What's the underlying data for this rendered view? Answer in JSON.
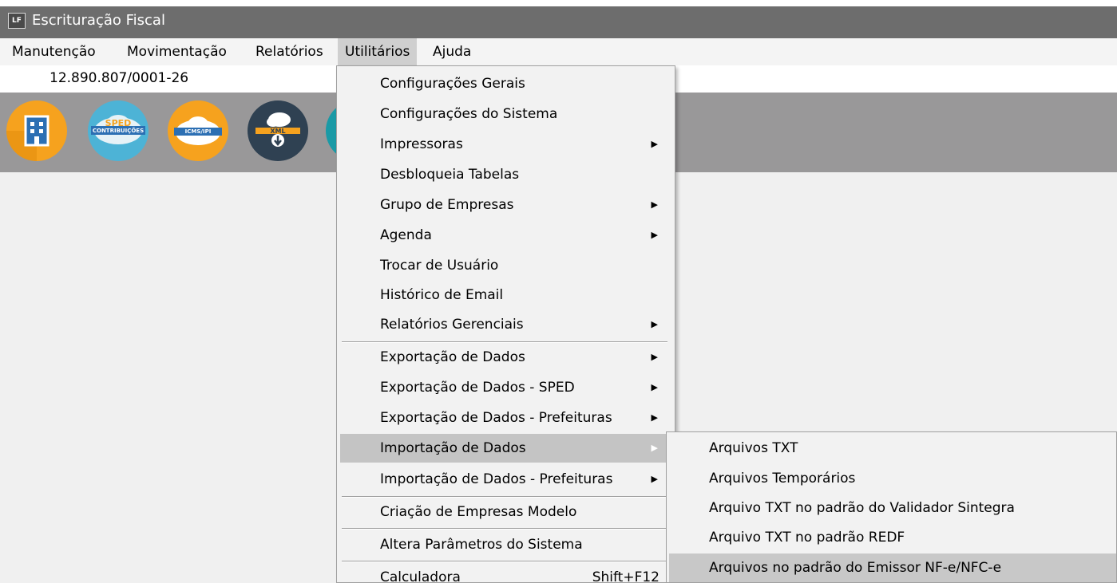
{
  "window": {
    "icon_text": "LF",
    "title": "Escrituração Fiscal"
  },
  "menubar": {
    "items": [
      "Manutenção",
      "Movimentação",
      "Relatórios",
      "Utilitários",
      "Ajuda"
    ],
    "active": "Utilitários"
  },
  "company": {
    "cnpj": "12.890.807/0001-26"
  },
  "toolbar": {
    "buttons": [
      {
        "name": "empresa-icon",
        "label": ""
      },
      {
        "name": "sped-contribuicoes-icon",
        "label_top": "SPED",
        "label_bottom": "CONTRIBUIÇÕES"
      },
      {
        "name": "icms-ipi-icon",
        "label": "ICMS/IPI"
      },
      {
        "name": "xml-icon",
        "label": "XML"
      }
    ]
  },
  "utilitarios_menu": {
    "items": [
      {
        "label": "Configurações Gerais"
      },
      {
        "label": "Configurações do Sistema"
      },
      {
        "label": "Impressoras",
        "submenu": true
      },
      {
        "label": "Desbloqueia Tabelas"
      },
      {
        "label": "Grupo de Empresas",
        "submenu": true
      },
      {
        "label": "Agenda",
        "submenu": true
      },
      {
        "label": "Trocar de Usuário"
      },
      {
        "label": "Histórico de Email"
      },
      {
        "label": "Relatórios Gerenciais",
        "submenu": true
      },
      {
        "label": "Exportação de Dados",
        "submenu": true
      },
      {
        "label": "Exportação de Dados - SPED",
        "submenu": true
      },
      {
        "label": "Exportação de Dados - Prefeituras",
        "submenu": true
      },
      {
        "label": "Importação de Dados",
        "submenu": true,
        "highlighted": true
      },
      {
        "label": "Importação de Dados - Prefeituras",
        "submenu": true
      },
      {
        "label": "Criação de Empresas Modelo"
      },
      {
        "label": "Altera Parâmetros do Sistema"
      },
      {
        "label": "Calculadora",
        "shortcut": "Shift+F12"
      }
    ]
  },
  "importacao_submenu": {
    "items": [
      {
        "label": "Arquivos TXT"
      },
      {
        "label": "Arquivos Temporários"
      },
      {
        "label": "Arquivo TXT no padrão do Validador Sintegra"
      },
      {
        "label": "Arquivo TXT no padrão REDF"
      },
      {
        "label": "Arquivos no padrão do Emissor NF-e/NFC-e",
        "highlighted": true
      }
    ]
  },
  "colors": {
    "titlebar": "#6d6d6d",
    "toolbar": "#999899",
    "highlight": "#c4c4c4",
    "icon_orange": "#f6a21e",
    "icon_blue": "#4db3d6",
    "icon_dark": "#2f4152"
  }
}
